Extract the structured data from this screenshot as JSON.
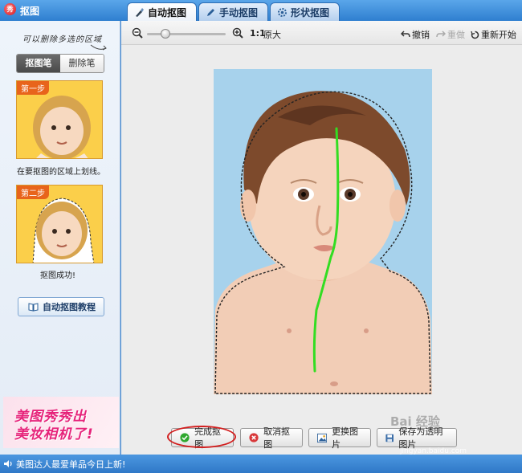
{
  "app": {
    "title": "抠图",
    "logo_text": "秀"
  },
  "tabs": [
    {
      "label": "自动抠图",
      "icon": "brush-icon",
      "active": true
    },
    {
      "label": "手动抠图",
      "icon": "pen-icon",
      "active": false
    },
    {
      "label": "形状抠图",
      "icon": "gear-shape-icon",
      "active": false
    }
  ],
  "sidebar": {
    "hint": "可以删除多选的区域",
    "brush_modes": [
      {
        "label": "抠图笔",
        "active": true
      },
      {
        "label": "删除笔",
        "active": false
      }
    ],
    "steps": [
      {
        "badge": "第一步",
        "caption": "在要抠图的区域上划线。"
      },
      {
        "badge": "第二步",
        "caption": "抠图成功!"
      }
    ],
    "tutorial_button": "自动抠图教程",
    "ad_lines": [
      "美图秀秀出",
      "美妆相机了!"
    ]
  },
  "toolbar": {
    "zoom_level": 0.2,
    "ratio": "1:1",
    "original_label": "原大",
    "undo": "撤销",
    "redo": "重做",
    "restart": "重新开始"
  },
  "actions": {
    "finish": "完成抠图",
    "cancel": "取消抠图",
    "change_image": "更换图片",
    "save": "保存为透明图片"
  },
  "watermark": {
    "text": "Bai 经验",
    "url": "jingyan.baidu.com"
  },
  "status": {
    "text": "美图达人最爱单品今日上新!"
  },
  "colors": {
    "accent_blue": "#2f7fd0",
    "highlight_red": "#d21f1f",
    "stroke_green": "#33dd22",
    "photo_background": "#a7d2ec"
  }
}
